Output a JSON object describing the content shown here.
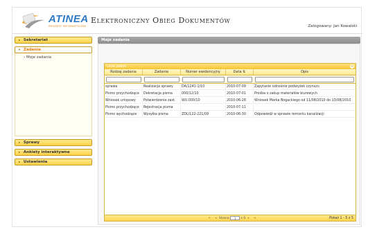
{
  "header": {
    "logo_text": "ATINEA",
    "logo_sub": "PROJEKTY INFORMATYCZNE",
    "app_title": "Elektroniczny Obieg Dokumentów",
    "user": "Zalogowany: Jan Kowalski"
  },
  "sidebar": {
    "sekretariat": "Sekretariat",
    "zadania": "Zadania",
    "moje_zadania": "Moje zadania",
    "sprawy": "Sprawy",
    "ankiety": "Ankiety interaktywne",
    "ustawienia": "Ustawienia"
  },
  "main": {
    "title": "Moje zadania",
    "grid_title": "Lista zadań",
    "columns": [
      "Rodzaj zadania",
      "Zadanie",
      "Numer ewidencyjny",
      "Data ⇅",
      "Opis"
    ],
    "rows": [
      [
        "sprawa",
        "Realizacja sprawy",
        "DA/1241-1/10",
        "2010-07-09",
        "Zapytanie odnośnie podwyżek czynszu"
      ],
      [
        "Pismo przychodzące",
        "Dekretacja pisma",
        "000/12/10",
        "2010-07-01",
        "Prośba o zakup materiałów biurowych"
      ],
      [
        "Wniosek urlopowy",
        "Potwierdzenie zast.",
        "WU.000/10",
        "2010-06-28",
        "Wniosek Marka Bogackiego od 11/08/2010 do 13/08/2010"
      ],
      [
        "Pismo przychodzące",
        "Rejestracja pisma",
        "",
        "2010-07-11",
        ""
      ],
      [
        "Pismo wychodzące",
        "Wysyłka pisma",
        "ZDL/122-221/09",
        "2010-06-30",
        "Odpowiedź w sprawie remontu kanalizacji"
      ]
    ],
    "pager": {
      "page_label": "Strona",
      "page_value": "1",
      "of_label": "z 0",
      "records": "Pokaż 1 - 5 z 5"
    }
  },
  "colors": {
    "accent": "#ffd24a",
    "brand": "#2e78c4",
    "active_text": "#e07b00"
  }
}
